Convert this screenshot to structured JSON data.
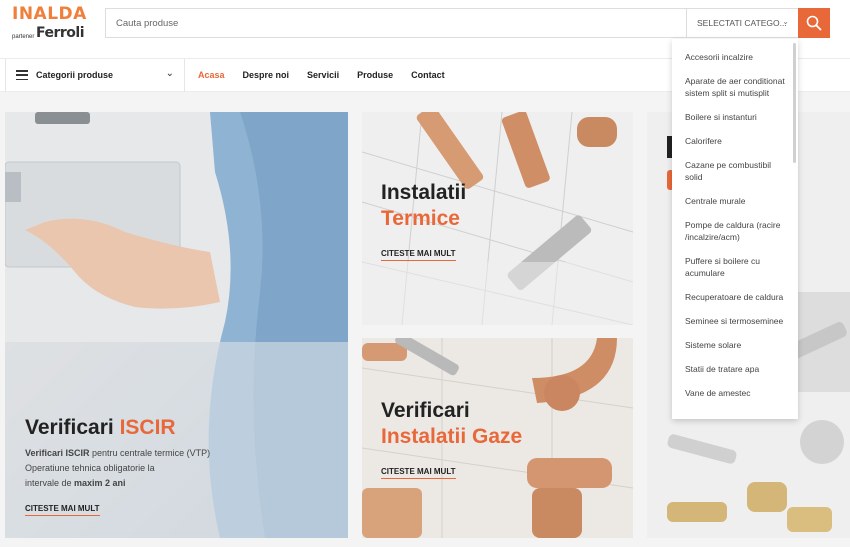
{
  "header": {
    "brand": "INALDA",
    "partner_prefix": "partener",
    "partner_name": "Ferroli",
    "search_placeholder": "Cauta produse",
    "category_select": "SELECTATI CATEGO...",
    "accent_color": "#e9683a"
  },
  "nav": {
    "categories_label": "Categorii produse",
    "links": [
      "Acasa",
      "Despre noi",
      "Servicii",
      "Produse",
      "Contact"
    ],
    "active": "Acasa"
  },
  "panels": {
    "iscir": {
      "title_main": "Verificari",
      "title_accent": "ISCIR",
      "desc_line1_bold": "Verificari ISCIR",
      "desc_line1_rest": " pentru centrale termice (VTP)",
      "desc_line2": "Operatiune tehnica obligatorie la",
      "desc_line3_prefix": "intervale de ",
      "desc_line3_bold": "maxim 2 ani",
      "cta": "CITESTE MAI MULT"
    },
    "termice": {
      "title_main": "Instalatii",
      "title_accent": "Termice",
      "cta": "CITESTE MAI MULT"
    },
    "gaze": {
      "title_main": "Verificari",
      "title_accent": "Instalatii Gaze",
      "cta": "CITESTE MAI MULT"
    }
  },
  "dropdown": {
    "items": [
      "Accesorii incalzire",
      "Aparate de aer conditionat sistem split si mutisplit",
      "Boilere si instanturi",
      "Calorifere",
      "Cazane pe combustibil solid",
      "Centrale murale",
      "Pompe de caldura (racire /incalzire/acm)",
      "Puffere si boilere cu acumulare",
      "Recuperatoare de caldura",
      "Seminee si termoseminee",
      "Sisteme solare",
      "Statii de tratare apa",
      "Vane de amestec"
    ]
  }
}
